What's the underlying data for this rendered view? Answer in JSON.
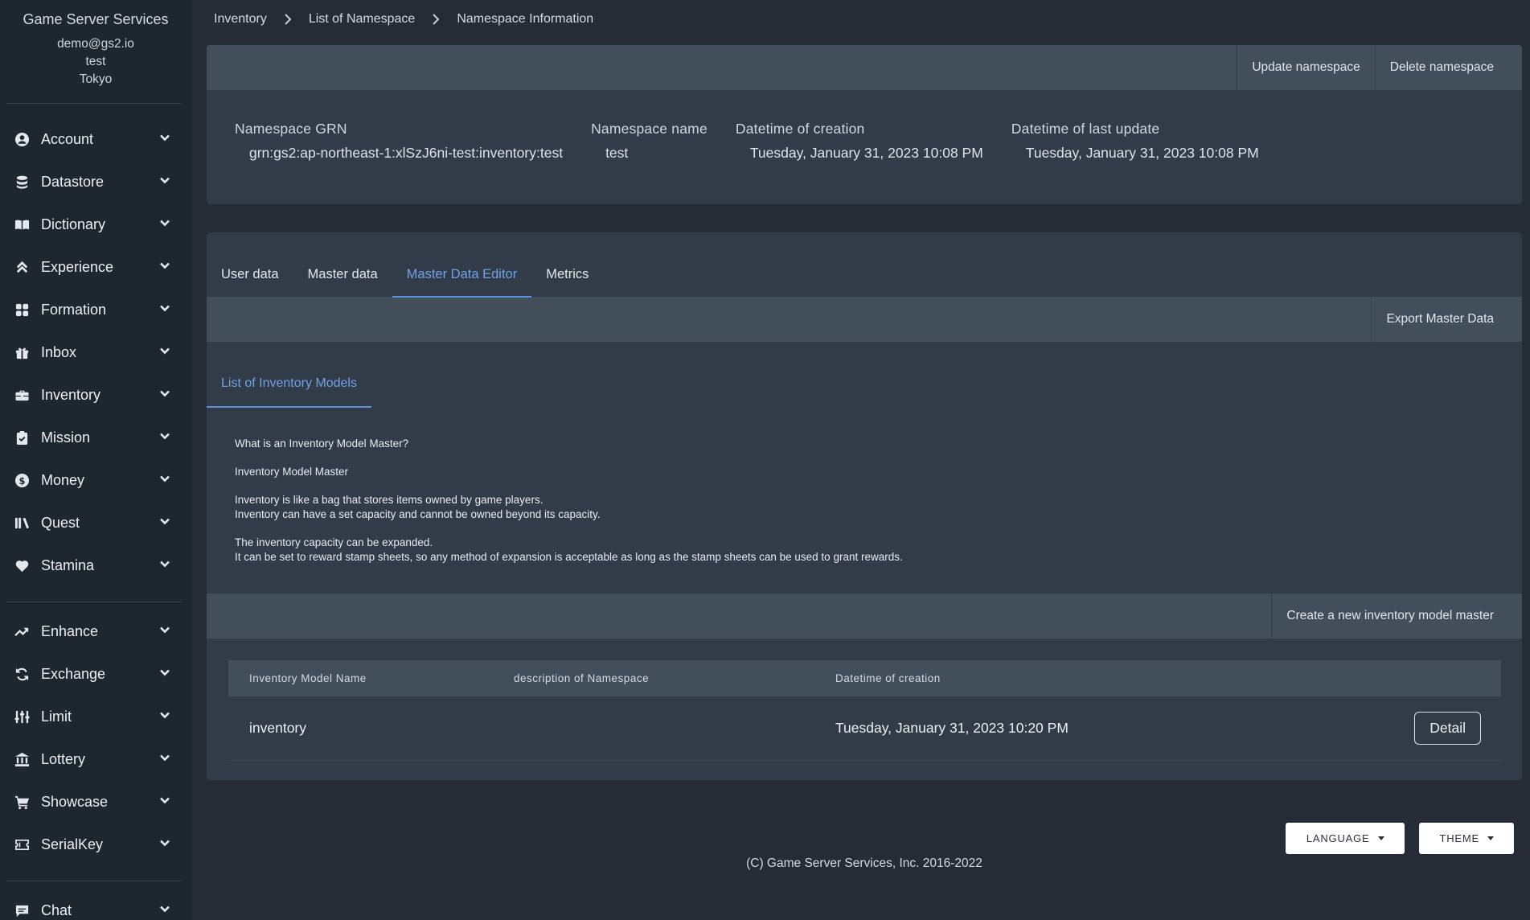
{
  "sidebar": {
    "title": "Game Server Services",
    "user_email": "demo@gs2.io",
    "project": "test",
    "region": "Tokyo",
    "groups": [
      [
        {
          "label": "Account",
          "icon": "account-icon"
        },
        {
          "label": "Datastore",
          "icon": "datastore-icon"
        },
        {
          "label": "Dictionary",
          "icon": "dictionary-icon"
        },
        {
          "label": "Experience",
          "icon": "experience-icon"
        },
        {
          "label": "Formation",
          "icon": "formation-icon"
        },
        {
          "label": "Inbox",
          "icon": "inbox-icon"
        },
        {
          "label": "Inventory",
          "icon": "inventory-icon"
        },
        {
          "label": "Mission",
          "icon": "mission-icon"
        },
        {
          "label": "Money",
          "icon": "money-icon"
        },
        {
          "label": "Quest",
          "icon": "quest-icon"
        },
        {
          "label": "Stamina",
          "icon": "stamina-icon"
        }
      ],
      [
        {
          "label": "Enhance",
          "icon": "enhance-icon"
        },
        {
          "label": "Exchange",
          "icon": "exchange-icon"
        },
        {
          "label": "Limit",
          "icon": "limit-icon"
        },
        {
          "label": "Lottery",
          "icon": "lottery-icon"
        },
        {
          "label": "Showcase",
          "icon": "showcase-icon"
        },
        {
          "label": "SerialKey",
          "icon": "serialkey-icon"
        }
      ],
      [
        {
          "label": "Chat",
          "icon": "chat-icon"
        }
      ]
    ]
  },
  "breadcrumb": [
    "Inventory",
    "List of Namespace",
    "Namespace Information"
  ],
  "namespace": {
    "actions": {
      "update": "Update namespace",
      "delete": "Delete namespace"
    },
    "fields": [
      {
        "key": "Namespace GRN",
        "value": "grn:gs2:ap-northeast-1:xlSzJ6ni-test:inventory:test"
      },
      {
        "key": "Namespace name",
        "value": "test"
      },
      {
        "key": "Datetime of creation",
        "value": "Tuesday, January 31, 2023 10:08 PM"
      },
      {
        "key": "Datetime of last update",
        "value": "Tuesday, January 31, 2023 10:08 PM"
      }
    ]
  },
  "tabs": {
    "items": [
      "User data",
      "Master data",
      "Master Data Editor",
      "Metrics"
    ],
    "active": "Master Data Editor"
  },
  "master_editor": {
    "export_label": "Export Master Data",
    "subtab": "List of Inventory Models",
    "description": {
      "question": "What is an Inventory Model Master?",
      "heading": "Inventory Model Master",
      "para1_line1": "Inventory is like a bag that stores items owned by game players.",
      "para1_line2": "Inventory can have a set capacity and cannot be owned beyond its capacity.",
      "para2_line1": "The inventory capacity can be expanded.",
      "para2_line2": "It can be set to reward stamp sheets, so any method of expansion is acceptable as long as the stamp sheets can be used to grant rewards."
    },
    "create_label": "Create a new inventory model master",
    "table": {
      "headers": [
        "Inventory Model Name",
        "description of Namespace",
        "Datetime of creation"
      ],
      "rows": [
        {
          "name": "inventory",
          "description": "",
          "created": "Tuesday, January 31, 2023 10:20 PM",
          "action": "Detail"
        }
      ]
    }
  },
  "footer": {
    "language_label": "LANGUAGE",
    "theme_label": "THEME",
    "copyright": "(C) Game Server Services, Inc. 2016-2022"
  }
}
